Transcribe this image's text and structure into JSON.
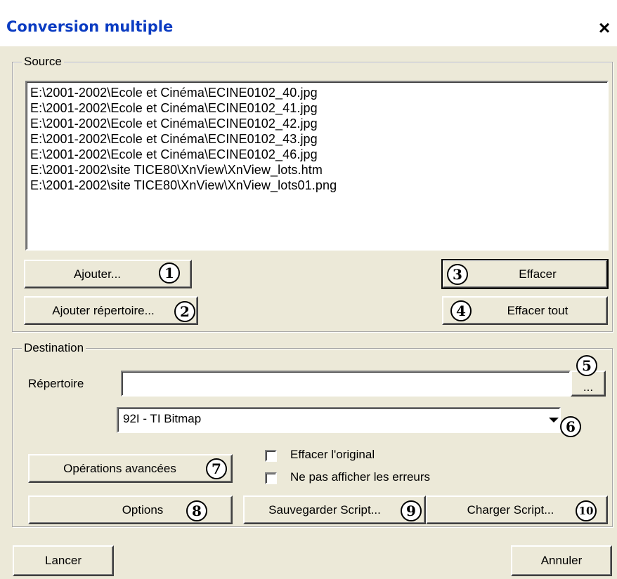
{
  "window": {
    "title": "Conversion multiple",
    "close_glyph": "×"
  },
  "source": {
    "legend": "Source",
    "files": [
      "E:\\2001-2002\\Ecole et Cinéma\\ECINE0102_40.jpg",
      "E:\\2001-2002\\Ecole et Cinéma\\ECINE0102_41.jpg",
      "E:\\2001-2002\\Ecole et Cinéma\\ECINE0102_42.jpg",
      "E:\\2001-2002\\Ecole et Cinéma\\ECINE0102_43.jpg",
      "E:\\2001-2002\\Ecole et Cinéma\\ECINE0102_46.jpg",
      "E:\\2001-2002\\site TICE80\\XnView\\XnView_lots.htm",
      "E:\\2001-2002\\site TICE80\\XnView\\XnView_lots01.png"
    ],
    "add_label": "Ajouter...",
    "add_folder_label": "Ajouter répertoire...",
    "clear_label": "Effacer",
    "clear_all_label": "Effacer tout"
  },
  "destination": {
    "legend": "Destination",
    "folder_label": "Répertoire",
    "folder_value": "",
    "browse_label": "...",
    "format_value": "92I - TI Bitmap",
    "advanced_label": "Opérations avancées",
    "delete_original_label": "Effacer l'original",
    "delete_original_checked": false,
    "hide_errors_label": "Ne pas afficher les erreurs",
    "hide_errors_checked": false,
    "options_label": "Options",
    "save_script_label": "Sauvegarder Script...",
    "load_script_label": "Charger Script..."
  },
  "footer": {
    "run_label": "Lancer",
    "cancel_label": "Annuler"
  },
  "annotations": [
    "1",
    "2",
    "3",
    "4",
    "5",
    "6",
    "7",
    "8",
    "9",
    "10"
  ]
}
